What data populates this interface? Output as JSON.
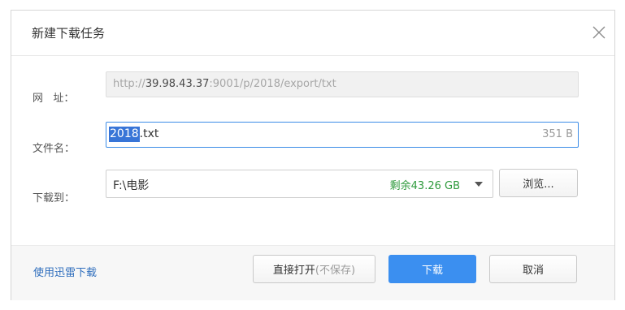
{
  "dialog": {
    "title": "新建下载任务",
    "close_icon": "close-icon"
  },
  "url": {
    "label": "网   址：",
    "prefix": "http://",
    "host": "39.98.43.37",
    "suffix": ":9001/p/2018/export/txt"
  },
  "filename": {
    "label": "文件名：",
    "selected_part": "2018",
    "rest_part": ".txt",
    "size": "351 B"
  },
  "save_to": {
    "label": "下载到：",
    "path": "F:\\电影",
    "free_space": "剩余43.26 GB",
    "dropdown_icon": "caret-down-icon",
    "browse_label": "浏览..."
  },
  "footer": {
    "xunlei_link": "使用迅雷下载",
    "open_label": "直接打开",
    "open_note": "(不保存)",
    "download_label": "下载",
    "cancel_label": "取消"
  },
  "colors": {
    "accent": "#3b8ff0",
    "free_space": "#2e9a3c",
    "link": "#2f6ebd",
    "selection": "#3875d7"
  }
}
